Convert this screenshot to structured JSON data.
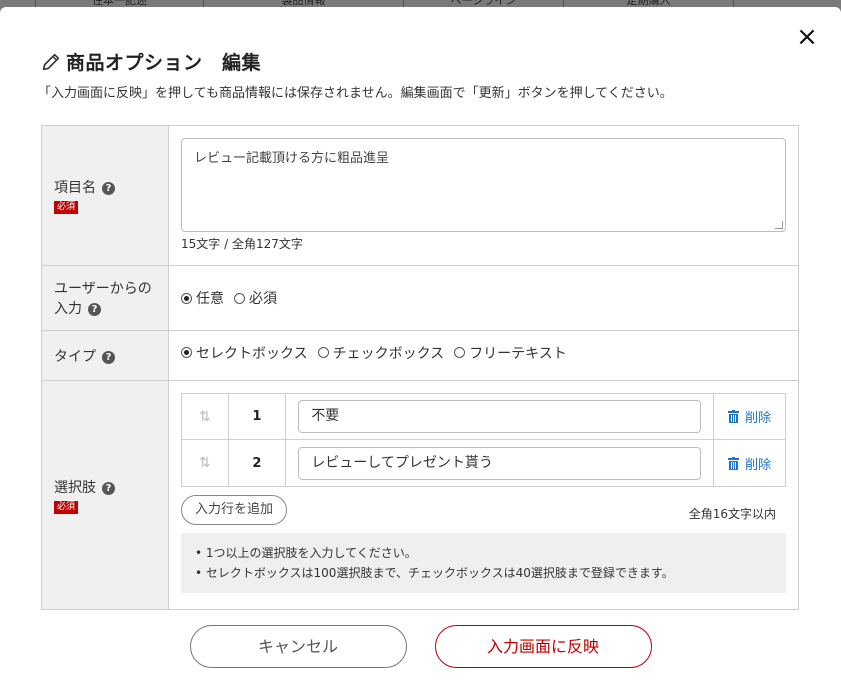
{
  "background_tabs": [
    "住本一記述",
    "製品情報",
    "ページライン",
    "定期購入"
  ],
  "modal": {
    "title": "商品オプション　編集",
    "description": "「入力画面に反映」を押しても商品情報には保存されません。編集画面で「更新」ボタンを押してください。",
    "close_label": "×"
  },
  "fields": {
    "item_name": {
      "label": "項目名",
      "required_badge": "必須",
      "value": "レビュー記載頂ける方に粗品進呈",
      "char_count": "15文字 / 全角127文字"
    },
    "user_input": {
      "label_line1": "ユーザーからの",
      "label_line2": "入力",
      "options": [
        "任意",
        "必須"
      ],
      "selected": "任意"
    },
    "type": {
      "label": "タイプ",
      "options": [
        "セレクトボックス",
        "チェックボックス",
        "フリーテキスト"
      ],
      "selected": "セレクトボックス"
    },
    "choices": {
      "label": "選択肢",
      "required_badge": "必須",
      "rows": [
        {
          "num": "1",
          "value": "不要",
          "delete_label": "削除"
        },
        {
          "num": "2",
          "value": "レビューしてプレゼント貰う",
          "delete_label": "削除"
        }
      ],
      "add_row_label": "入力行を追加",
      "limit_text": "全角16文字以内",
      "notes": [
        "• 1つ以上の選択肢を入力してください。",
        "• セレクトボックスは100選択肢まで、チェックボックスは40選択肢まで登録できます。"
      ]
    }
  },
  "buttons": {
    "cancel": "キャンセル",
    "apply": "入力画面に反映"
  },
  "colors": {
    "accent_red": "#c00000",
    "link_blue": "#1a73c8"
  }
}
